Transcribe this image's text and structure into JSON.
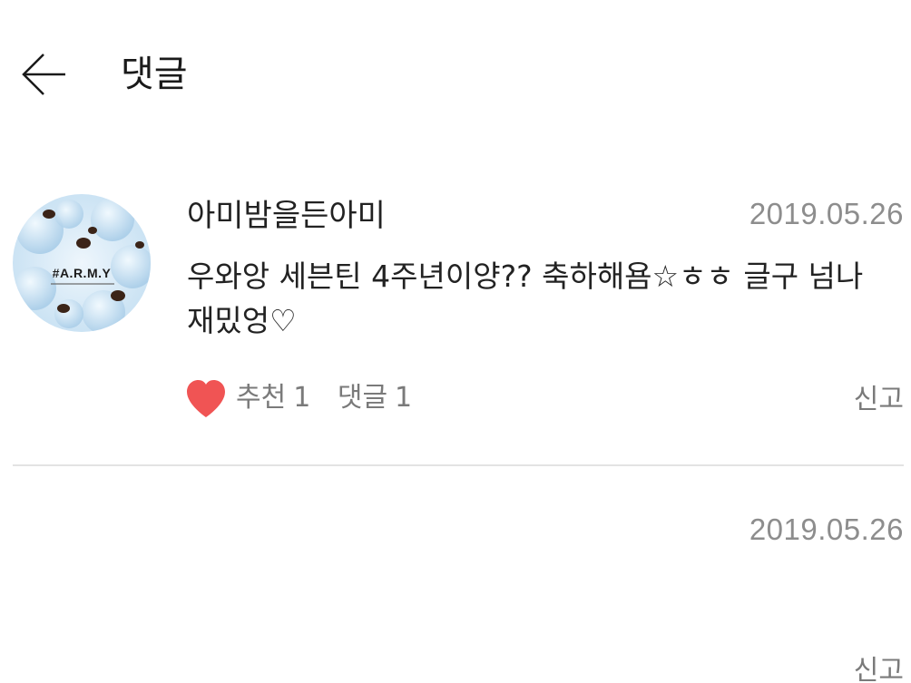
{
  "header": {
    "title": "댓글",
    "back_icon": "back-arrow-icon"
  },
  "comments": [
    {
      "author": "아미밤을든아미",
      "date": "2019.05.26",
      "text": "우와앙 세븐틴 4주년이양?? 축하해욤☆ㅎㅎ 글구 넘나 재밌엉♡",
      "like_icon": "heart-icon",
      "like_color": "#f05454",
      "like_label": "추천",
      "like_count": "1",
      "reply_label": "댓글",
      "reply_count": "1",
      "report": "신고",
      "avatar": {
        "text": "#A.R.M.Y"
      }
    },
    {
      "author": "",
      "date": "2019.05.26",
      "text": "",
      "report": "신고"
    }
  ]
}
